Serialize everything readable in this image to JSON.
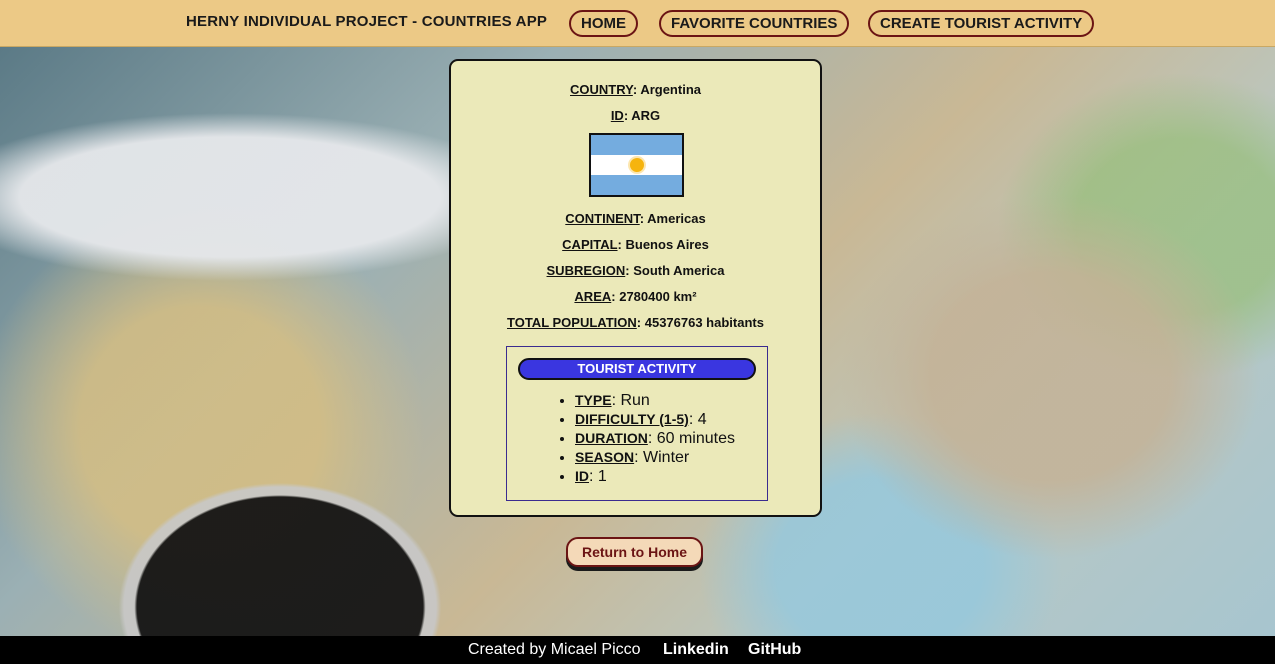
{
  "navbar": {
    "brand": "HERNY INDIVIDUAL PROJECT - COUNTRIES APP",
    "links": [
      "HOME",
      "FAVORITE COUNTRIES",
      "CREATE TOURIST ACTIVITY"
    ]
  },
  "country": {
    "country_label": "COUNTRY",
    "country_value": "Argentina",
    "id_label": "ID",
    "id_value": "ARG",
    "flag_alt": "argentina-flag",
    "continent_label": "CONTINENT",
    "continent_value": "Americas",
    "capital_label": "CAPITAL",
    "capital_value": "Buenos Aires",
    "subregion_label": "SUBREGION",
    "subregion_value": "South America",
    "area_label": "AREA",
    "area_value": "2780400 km²",
    "population_label": "TOTAL POPULATION",
    "population_value": "45376763 habitants"
  },
  "activity": {
    "title": "TOURIST ACTIVITY",
    "type_label": "TYPE",
    "type_value": "Run",
    "difficulty_label": "DIFFICULTY (1-5)",
    "difficulty_value": "4",
    "duration_label": "DURATION",
    "duration_value": "60 minutes",
    "season_label": "SEASON",
    "season_value": "Winter",
    "id_label": "ID",
    "id_value": "1"
  },
  "return_button": "Return to Home",
  "footer": {
    "credit": "Created by Micael Picco",
    "linkedin": "Linkedin",
    "github": "GitHub"
  },
  "colors": {
    "navbar": "#ecc986",
    "card": "#ebe9b9",
    "activity_header": "#3a36e0",
    "button_border": "#6b1414"
  }
}
